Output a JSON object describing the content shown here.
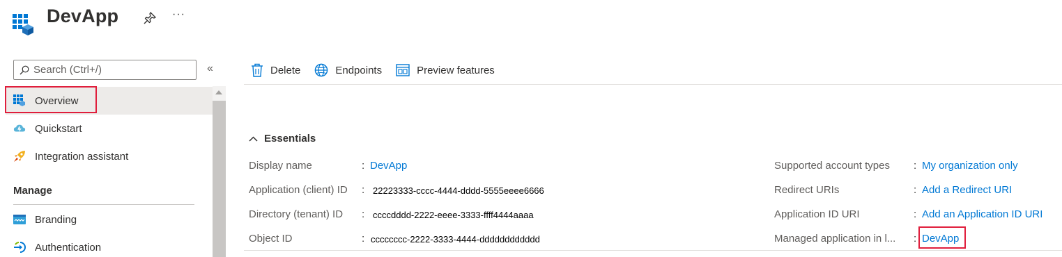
{
  "header": {
    "title": "DevApp",
    "more_label": "···"
  },
  "sidebar": {
    "search_placeholder": "Search (Ctrl+/)",
    "collapse_label": "«",
    "items": [
      {
        "label": "Overview",
        "icon": "app-grid-icon",
        "active": true
      },
      {
        "label": "Quickstart",
        "icon": "cloud-icon"
      },
      {
        "label": "Integration assistant",
        "icon": "rocket-icon"
      }
    ],
    "section_manage": "Manage",
    "manage_items": [
      {
        "label": "Branding",
        "icon": "branding-icon"
      },
      {
        "label": "Authentication",
        "icon": "authentication-icon"
      }
    ]
  },
  "toolbar": {
    "delete_label": "Delete",
    "endpoints_label": "Endpoints",
    "preview_label": "Preview features"
  },
  "essentials": {
    "heading": "Essentials",
    "left": [
      {
        "label": "Display name",
        "value": "DevApp",
        "is_link": true
      },
      {
        "label": "Application (client) ID",
        "value": "22223333-cccc-4444-dddd-5555eeee6666"
      },
      {
        "label": "Directory (tenant) ID",
        "value": "ccccdddd-2222-eeee-3333-ffff4444aaaa"
      },
      {
        "label": "Object ID",
        "value": "cccccccc-2222-3333-4444-dddddddddddd"
      }
    ],
    "right": [
      {
        "label": "Supported account types",
        "value": "My organization only"
      },
      {
        "label": "Redirect URIs",
        "value": "Add a Redirect URI"
      },
      {
        "label": "Application ID URI",
        "value": "Add an Application ID URI"
      },
      {
        "label": "Managed application in l...",
        "value": "DevApp"
      }
    ],
    "colon": ":"
  },
  "colors": {
    "link": "#0078d4",
    "highlight": "#e01e3c",
    "active_bg": "#edebe9"
  }
}
